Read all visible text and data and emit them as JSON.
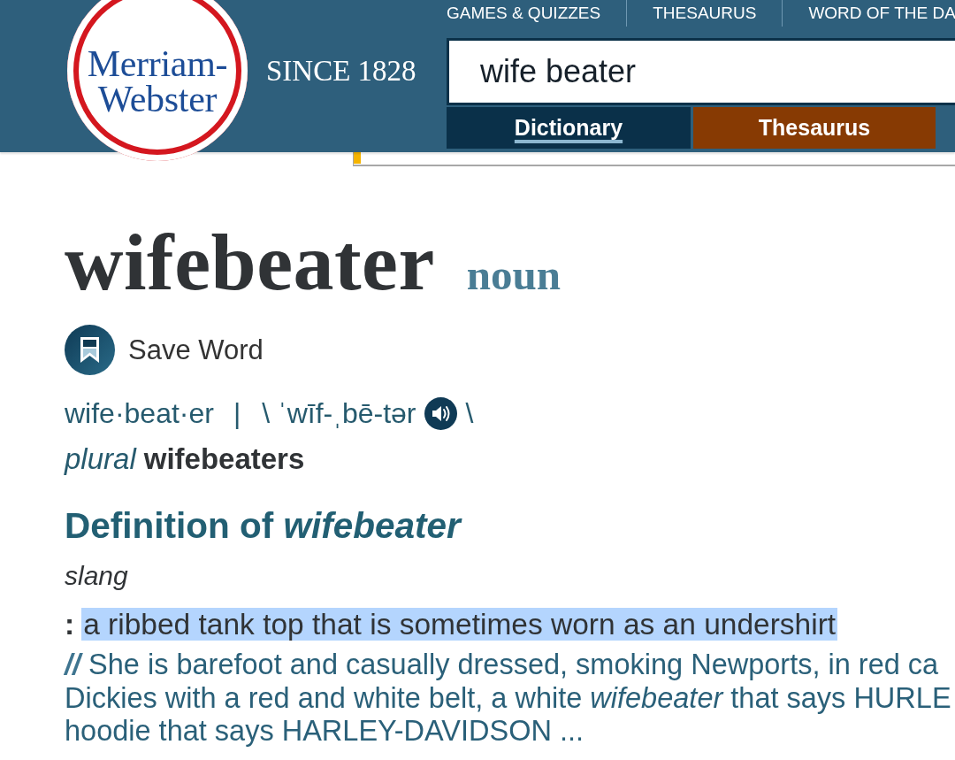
{
  "header": {
    "logo_lines": [
      "Merriam-",
      "Webster"
    ],
    "tagline": "SINCE 1828",
    "nav": [
      "GAMES & QUIZZES",
      "THESAURUS",
      "WORD OF THE DA"
    ],
    "search": {
      "value": "wife beater"
    },
    "tabs": [
      {
        "label": "Dictionary",
        "selected": true,
        "color": "#0a3049"
      },
      {
        "label": "Thesaurus",
        "selected": false,
        "color": "#873a03"
      }
    ]
  },
  "entry": {
    "headword": "wifebeater",
    "part_of_speech": "noun",
    "save_label": "Save Word",
    "syllables": "wife·beat·er",
    "separator": "|",
    "pronunciation": "\\ ˈwīf-ˌbē-tər",
    "pronunciation_end": "\\",
    "plural_label": "plural",
    "plural": "wifebeaters"
  },
  "definition": {
    "title": "Definition of *wifebeater*",
    "label": "slang",
    "colon": ":",
    "text": "a ribbed tank top that is sometimes worn as an undershirt",
    "highlighted": true,
    "example_lines": [
      "**//** She is barefoot and casually dressed, smoking Newports, in red ca",
      "Dickies with a red and white belt, a white *wifebeater* that says HURLE",
      "hoodie that says HARLEY-DAVIDSON ..."
    ]
  }
}
